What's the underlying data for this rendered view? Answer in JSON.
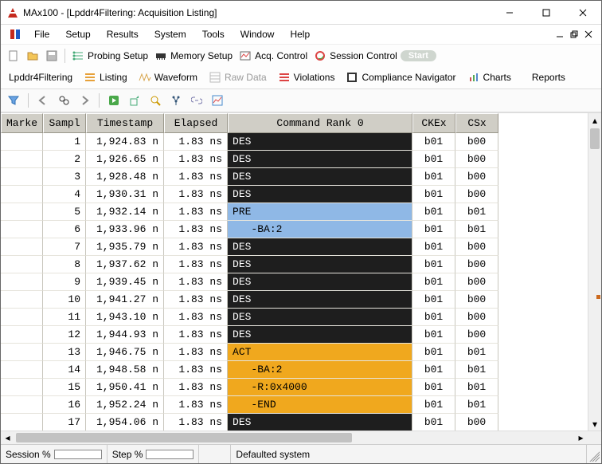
{
  "window": {
    "title": "MAx100 - [Lpddr4Filtering: Acquisition Listing]"
  },
  "menu": {
    "items": [
      "File",
      "Setup",
      "Results",
      "System",
      "Tools",
      "Window",
      "Help"
    ]
  },
  "toolbar1": {
    "probing": "Probing Setup",
    "memory": "Memory Setup",
    "acq": "Acq. Control",
    "session": "Session Control",
    "start": "Start"
  },
  "viewtabs": {
    "label": "Lpddr4Filtering",
    "listing": "Listing",
    "waveform": "Waveform",
    "rawdata": "Raw Data",
    "violations": "Violations",
    "compliance": "Compliance Navigator",
    "charts": "Charts",
    "reports": "Reports"
  },
  "columns": {
    "marker": "Marke",
    "sample": "Sampl",
    "timestamp": "Timestamp",
    "elapsed": "Elapsed",
    "command": "Command Rank 0",
    "cke": "CKEx",
    "csx": "CSx"
  },
  "rows": [
    {
      "n": 1,
      "ts": "1,924.83 n",
      "el": "1.83 ns",
      "cmd": "DES",
      "cls": "cmd-des",
      "cke": "b01",
      "csx": "b00",
      "hl": true
    },
    {
      "n": 2,
      "ts": "1,926.65 n",
      "el": "1.83 ns",
      "cmd": "DES",
      "cls": "cmd-des",
      "cke": "b01",
      "csx": "b00"
    },
    {
      "n": 3,
      "ts": "1,928.48 n",
      "el": "1.83 ns",
      "cmd": "DES",
      "cls": "cmd-des",
      "cke": "b01",
      "csx": "b00"
    },
    {
      "n": 4,
      "ts": "1,930.31 n",
      "el": "1.83 ns",
      "cmd": "DES",
      "cls": "cmd-des",
      "cke": "b01",
      "csx": "b00"
    },
    {
      "n": 5,
      "ts": "1,932.14 n",
      "el": "1.83 ns",
      "cmd": "PRE",
      "cls": "cmd-pre",
      "cke": "b01",
      "csx": "b01"
    },
    {
      "n": 6,
      "ts": "1,933.96 n",
      "el": "1.83 ns",
      "cmd": "   -BA:2",
      "cls": "cmd-pre-sub",
      "cke": "b01",
      "csx": "b01"
    },
    {
      "n": 7,
      "ts": "1,935.79 n",
      "el": "1.83 ns",
      "cmd": "DES",
      "cls": "cmd-des",
      "cke": "b01",
      "csx": "b00"
    },
    {
      "n": 8,
      "ts": "1,937.62 n",
      "el": "1.83 ns",
      "cmd": "DES",
      "cls": "cmd-des",
      "cke": "b01",
      "csx": "b00"
    },
    {
      "n": 9,
      "ts": "1,939.45 n",
      "el": "1.83 ns",
      "cmd": "DES",
      "cls": "cmd-des",
      "cke": "b01",
      "csx": "b00"
    },
    {
      "n": 10,
      "ts": "1,941.27 n",
      "el": "1.83 ns",
      "cmd": "DES",
      "cls": "cmd-des",
      "cke": "b01",
      "csx": "b00"
    },
    {
      "n": 11,
      "ts": "1,943.10 n",
      "el": "1.83 ns",
      "cmd": "DES",
      "cls": "cmd-des",
      "cke": "b01",
      "csx": "b00"
    },
    {
      "n": 12,
      "ts": "1,944.93 n",
      "el": "1.83 ns",
      "cmd": "DES",
      "cls": "cmd-des",
      "cke": "b01",
      "csx": "b00"
    },
    {
      "n": 13,
      "ts": "1,946.75 n",
      "el": "1.83 ns",
      "cmd": "ACT",
      "cls": "cmd-act",
      "cke": "b01",
      "csx": "b01"
    },
    {
      "n": 14,
      "ts": "1,948.58 n",
      "el": "1.83 ns",
      "cmd": "   -BA:2",
      "cls": "cmd-act-sub",
      "cke": "b01",
      "csx": "b01"
    },
    {
      "n": 15,
      "ts": "1,950.41 n",
      "el": "1.83 ns",
      "cmd": "   -R:0x4000",
      "cls": "cmd-act-sub",
      "cke": "b01",
      "csx": "b01"
    },
    {
      "n": 16,
      "ts": "1,952.24 n",
      "el": "1.83 ns",
      "cmd": "   -END",
      "cls": "cmd-act-sub",
      "cke": "b01",
      "csx": "b01"
    },
    {
      "n": 17,
      "ts": "1,954.06 n",
      "el": "1.83 ns",
      "cmd": "DES",
      "cls": "cmd-des",
      "cke": "b01",
      "csx": "b00"
    }
  ],
  "status": {
    "session": "Session %",
    "step": "Step %",
    "defaulted": "Defaulted system"
  }
}
